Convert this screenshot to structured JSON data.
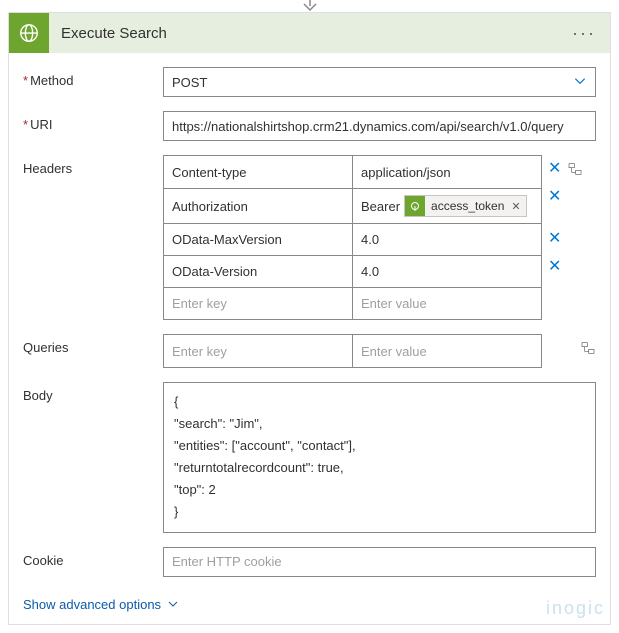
{
  "header": {
    "title": "Execute Search"
  },
  "fields": {
    "method_label": "Method",
    "method_value": "POST",
    "uri_label": "URI",
    "uri_value": "https://nationalshirtshop.crm21.dynamics.com/api/search/v1.0/query",
    "headers_label": "Headers",
    "queries_label": "Queries",
    "body_label": "Body",
    "cookie_label": "Cookie",
    "cookie_placeholder": "Enter HTTP cookie",
    "key_placeholder": "Enter key",
    "value_placeholder": "Enter value"
  },
  "headers": [
    {
      "key": "Content-type",
      "value": "application/json",
      "removable": true,
      "tokens": []
    },
    {
      "key": "Authorization",
      "value": "Bearer",
      "removable": true,
      "tokens": [
        {
          "label": "access_token"
        }
      ]
    },
    {
      "key": "OData-MaxVersion",
      "value": "4.0",
      "removable": true,
      "tokens": []
    },
    {
      "key": "OData-Version",
      "value": "4.0",
      "removable": true,
      "tokens": []
    }
  ],
  "body_lines": [
    "{",
    "\"search\": \"Jim\",",
    "\"entities\": [\"account\", \"contact\"],",
    "\"returntotalrecordcount\": true,",
    "\"top\": 2",
    "}"
  ],
  "footer": {
    "advanced": "Show advanced options"
  },
  "watermark": "inogic"
}
